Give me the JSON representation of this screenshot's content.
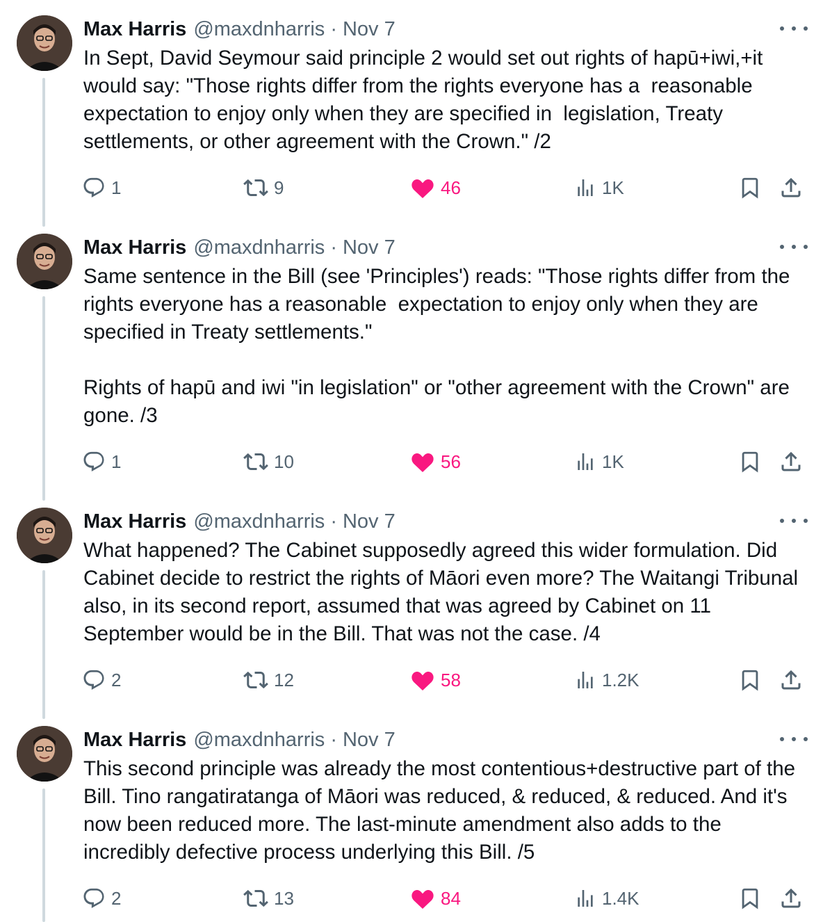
{
  "author": {
    "name": "Max Harris",
    "handle": "@maxdnharris",
    "separator": "·",
    "date": "Nov 7"
  },
  "colors": {
    "like": "#f91880",
    "muted": "#536471",
    "text": "#0f1419",
    "thread_line": "#cfd9de"
  },
  "icons": {
    "reply": "reply-icon",
    "retweet": "retweet-icon",
    "like": "heart-icon",
    "views": "views-icon",
    "bookmark": "bookmark-icon",
    "share": "share-icon",
    "more": "more-icon"
  },
  "tweets": [
    {
      "text": "In Sept, David Seymour said principle 2 would set out rights of hapū+iwi,+it would say: \"Those rights differ from the rights everyone has a  reasonable expectation to enjoy only when they are specified in  legislation, Treaty settlements, or other agreement with the Crown.\" /2",
      "replies": "1",
      "retweets": "9",
      "likes": "46",
      "views": "1K"
    },
    {
      "text": "Same sentence in the Bill (see 'Principles') reads: \"Those rights differ from the rights everyone has a reasonable  expectation to enjoy only when they are specified in Treaty settlements.\"\n\nRights of hapū and iwi \"in legislation\" or \"other agreement with the Crown\" are gone. /3",
      "replies": "1",
      "retweets": "10",
      "likes": "56",
      "views": "1K"
    },
    {
      "text": "What happened? The Cabinet supposedly agreed this wider formulation. Did Cabinet decide to restrict the rights of Māori even more? The Waitangi Tribunal also, in its second report, assumed that was agreed by Cabinet on 11 September would be in the Bill. That was not the case. /4",
      "replies": "2",
      "retweets": "12",
      "likes": "58",
      "views": "1.2K"
    },
    {
      "text": "This second principle was already the most contentious+destructive part of the Bill. Tino rangatiratanga of Māori was reduced, & reduced, & reduced. And it's now been reduced more. The last-minute amendment also adds to the incredibly defective process underlying this Bill. /5",
      "replies": "2",
      "retweets": "13",
      "likes": "84",
      "views": "1.4K"
    }
  ]
}
